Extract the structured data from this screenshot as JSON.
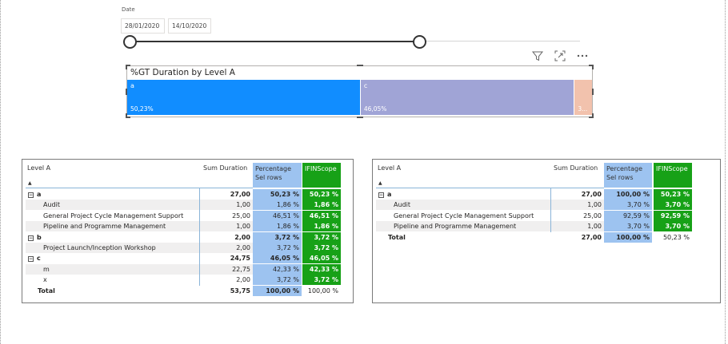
{
  "slicer": {
    "title": "Date",
    "start_date": "28/01/2020",
    "end_date": "14/10/2020"
  },
  "visual_header": {
    "icons": [
      "filter-icon",
      "focus-mode-icon",
      "more-options-icon"
    ]
  },
  "bar_chart": {
    "title": "%GT Duration by Level A",
    "segments": [
      {
        "label": "a",
        "value": "50,23%",
        "color": "#118dff",
        "share": 50.23
      },
      {
        "label": "c",
        "value": "46,05%",
        "color": "#a0a4d6",
        "share": 46.05
      },
      {
        "label": "",
        "value": "3...",
        "color": "#f2c2ad",
        "share": 3.72
      }
    ]
  },
  "matrix_left": {
    "headers": {
      "level": "Level A",
      "sum": "Sum Duration",
      "pct_line1": "Percentage",
      "pct_line2": "Sel rows",
      "ifin": "IFINScope"
    },
    "rows": [
      {
        "kind": "group",
        "expander": "−",
        "label": "a",
        "sum": "27,00",
        "pct": "50,23 %",
        "ifin": "50,23 %"
      },
      {
        "kind": "child",
        "label": "Audit",
        "sum": "1,00",
        "pct": "1,86 %",
        "ifin": "1,86 %"
      },
      {
        "kind": "child",
        "label": "General Project Cycle Management Support",
        "sum": "25,00",
        "pct": "46,51 %",
        "ifin": "46,51 %"
      },
      {
        "kind": "child",
        "label": "Pipeline and Programme Management",
        "sum": "1,00",
        "pct": "1,86 %",
        "ifin": "1,86 %"
      },
      {
        "kind": "group",
        "expander": "−",
        "label": "b",
        "sum": "2,00",
        "pct": "3,72 %",
        "ifin": "3,72 %"
      },
      {
        "kind": "child",
        "label": "Project Launch/Inception Workshop",
        "sum": "2,00",
        "pct": "3,72 %",
        "ifin": "3,72 %"
      },
      {
        "kind": "group",
        "expander": "−",
        "label": "c",
        "sum": "24,75",
        "pct": "46,05 %",
        "ifin": "46,05 %"
      },
      {
        "kind": "child",
        "label": "m",
        "sum": "22,75",
        "pct": "42,33 %",
        "ifin": "42,33 %"
      },
      {
        "kind": "child",
        "label": "x",
        "sum": "2,00",
        "pct": "3,72 %",
        "ifin": "3,72 %"
      },
      {
        "kind": "total",
        "label": "Total",
        "sum": "53,75",
        "pct": "100,00 %",
        "ifin": "100,00 %"
      }
    ]
  },
  "matrix_right": {
    "headers": {
      "level": "Level A",
      "sum": "Sum Duration",
      "pct_line1": "Percentage",
      "pct_line2": "Sel rows",
      "ifin": "IFINScope"
    },
    "rows": [
      {
        "kind": "group",
        "expander": "−",
        "label": "a",
        "sum": "27,00",
        "pct": "100,00 %",
        "ifin": "50,23 %"
      },
      {
        "kind": "child",
        "label": "Audit",
        "sum": "1,00",
        "pct": "3,70 %",
        "ifin": "3,70 %"
      },
      {
        "kind": "child",
        "label": "General Project Cycle Management Support",
        "sum": "25,00",
        "pct": "92,59 %",
        "ifin": "92,59 %"
      },
      {
        "kind": "child",
        "label": "Pipeline and Programme Management",
        "sum": "1,00",
        "pct": "3,70 %",
        "ifin": "3,70 %"
      },
      {
        "kind": "total",
        "label": "Total",
        "sum": "27,00",
        "pct": "100,00 %",
        "ifin": "50,23 %"
      }
    ]
  }
}
